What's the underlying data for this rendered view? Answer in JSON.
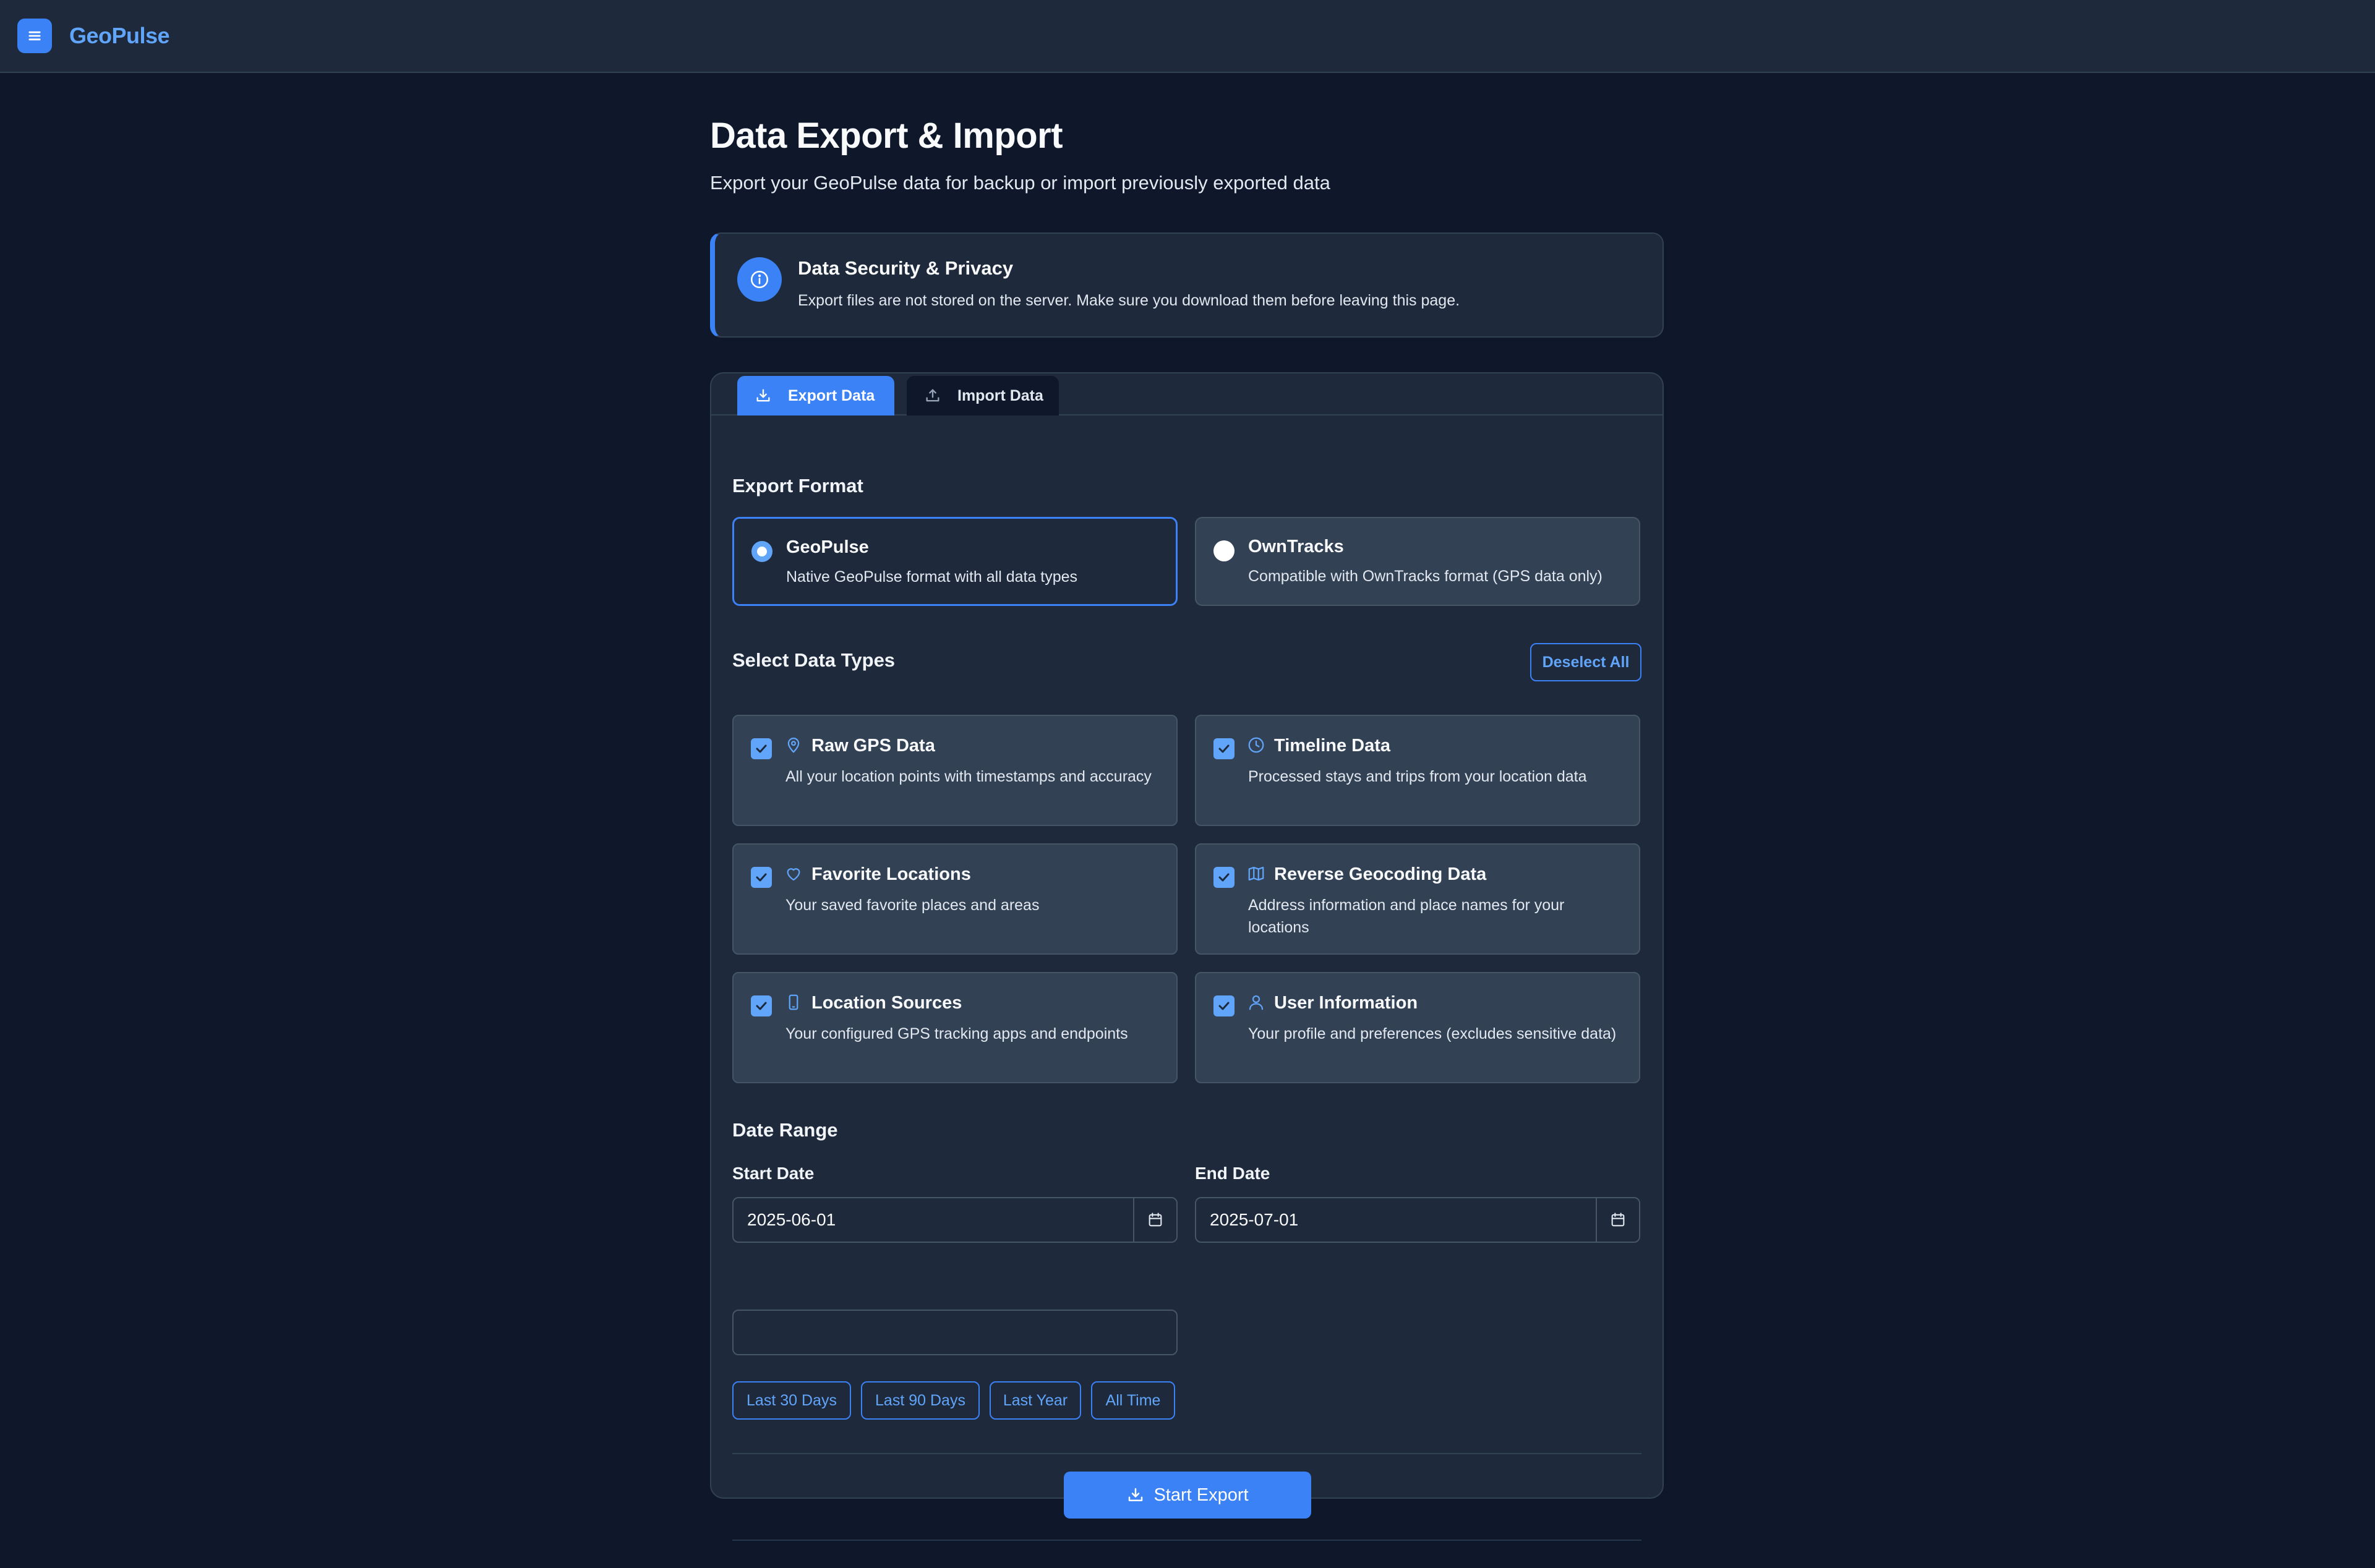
{
  "app": {
    "brand": "GeoPulse"
  },
  "page": {
    "title": "Data Export & Import",
    "subtitle": "Export your GeoPulse data for backup or import previously exported data"
  },
  "notice": {
    "title": "Data Security & Privacy",
    "text": "Export files are not stored on the server. Make sure you download them before leaving this page."
  },
  "tabs": [
    {
      "label": "Export Data",
      "active": true
    },
    {
      "label": "Import Data",
      "active": false
    }
  ],
  "export_format": {
    "heading": "Export Format",
    "options": [
      {
        "title": "GeoPulse",
        "description": "Native GeoPulse format with all data types",
        "selected": true
      },
      {
        "title": "OwnTracks",
        "description": "Compatible with OwnTracks format (GPS data only)",
        "selected": false
      }
    ]
  },
  "data_types": {
    "heading": "Select Data Types",
    "deselect_label": "Deselect All",
    "items": [
      {
        "title": "Raw GPS Data",
        "description": "All your location points with timestamps and accuracy",
        "icon": "map-pin-icon",
        "checked": true
      },
      {
        "title": "Timeline Data",
        "description": "Processed stays and trips from your location data",
        "icon": "clock-icon",
        "checked": true
      },
      {
        "title": "Favorite Locations",
        "description": "Your saved favorite places and areas",
        "icon": "heart-icon",
        "checked": true
      },
      {
        "title": "Reverse Geocoding Data",
        "description": "Address information and place names for your locations",
        "icon": "map-icon",
        "checked": true
      },
      {
        "title": "Location Sources",
        "description": "Your configured GPS tracking apps and endpoints",
        "icon": "mobile-icon",
        "checked": true
      },
      {
        "title": "User Information",
        "description": "Your profile and preferences (excludes sensitive data)",
        "icon": "user-icon",
        "checked": true
      }
    ]
  },
  "date_range": {
    "heading": "Date Range",
    "start_label": "Start Date",
    "start_value": "2025-06-01",
    "end_label": "End Date",
    "end_value": "2025-07-01",
    "quick_ranges": [
      "Last 30 Days",
      "Last 90 Days",
      "Last Year",
      "All Time"
    ]
  },
  "actions": {
    "start_export": "Start Export"
  },
  "colors": {
    "accent": "#3b82f6",
    "accent_light": "#60a5fa",
    "background": "#0f172a",
    "surface": "#1e293b",
    "card": "#334155"
  }
}
